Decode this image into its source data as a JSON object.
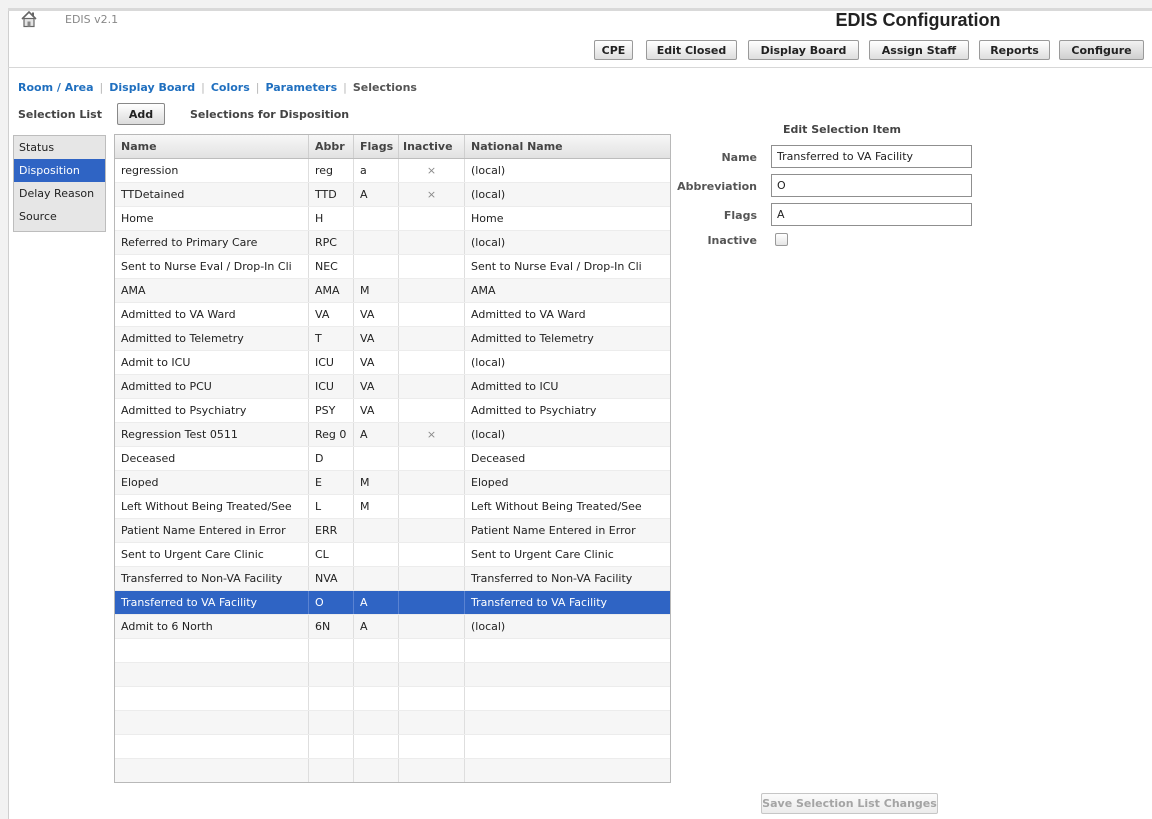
{
  "header": {
    "version": "EDIS v2.1",
    "title": "EDIS Configuration",
    "home_icon": "home-icon"
  },
  "nav": {
    "buttons": [
      "CPE",
      "Edit Closed",
      "Display Board",
      "Assign Staff",
      "Reports",
      "Configure"
    ],
    "active": "Configure"
  },
  "subnav": {
    "links": [
      "Room / Area",
      "Display Board",
      "Colors",
      "Parameters"
    ],
    "current": "Selections"
  },
  "selection_list": {
    "label": "Selection List",
    "items": [
      "Status",
      "Disposition",
      "Delay Reason",
      "Source"
    ],
    "selected": "Disposition"
  },
  "selections": {
    "add_label": "Add",
    "heading": "Selections for Disposition",
    "columns": [
      "Name",
      "Abbr",
      "Flags",
      "Inactive",
      "National Name"
    ],
    "rows": [
      [
        "regression",
        "reg",
        "a",
        "×",
        "(local)"
      ],
      [
        "TTDetained",
        "TTD",
        "A",
        "×",
        "(local)"
      ],
      [
        "Home",
        "H",
        "",
        "",
        "Home"
      ],
      [
        "Referred to Primary Care",
        "RPC",
        "",
        "",
        "(local)"
      ],
      [
        "Sent to Nurse Eval / Drop-In Cli",
        "NEC",
        "",
        "",
        "Sent to Nurse Eval / Drop-In Cli"
      ],
      [
        "AMA",
        "AMA",
        "M",
        "",
        "AMA"
      ],
      [
        "Admitted to VA Ward",
        "VA",
        "VA",
        "",
        "Admitted to VA Ward"
      ],
      [
        "Admitted to Telemetry",
        "T",
        "VA",
        "",
        "Admitted to Telemetry"
      ],
      [
        "Admit to ICU",
        "ICU",
        "VA",
        "",
        "(local)"
      ],
      [
        "Admitted to PCU",
        "ICU",
        "VA",
        "",
        "Admitted to ICU"
      ],
      [
        "Admitted to Psychiatry",
        "PSY",
        "VA",
        "",
        "Admitted to Psychiatry"
      ],
      [
        "Regression Test 0511",
        "Reg 0",
        "A",
        "×",
        "(local)"
      ],
      [
        "Deceased",
        "D",
        "",
        "",
        "Deceased"
      ],
      [
        "Eloped",
        "E",
        "M",
        "",
        "Eloped"
      ],
      [
        "Left Without Being Treated/See",
        "L",
        "M",
        "",
        "Left Without Being Treated/See"
      ],
      [
        "Patient Name Entered in Error",
        "ERR",
        "",
        "",
        "Patient Name Entered in Error"
      ],
      [
        "Sent to Urgent Care Clinic",
        "CL",
        "",
        "",
        "Sent to Urgent Care Clinic"
      ],
      [
        "Transferred to Non-VA Facility",
        "NVA",
        "",
        "",
        "Transferred to Non-VA Facility"
      ],
      [
        "Transferred to VA Facility",
        "O",
        "A",
        "",
        "Transferred to VA Facility"
      ],
      [
        "Admit to 6 North",
        "6N",
        "A",
        "",
        "(local)"
      ]
    ],
    "selected_row": 18
  },
  "edit": {
    "title": "Edit Selection Item",
    "name_label": "Name",
    "name_value": "Transferred to VA Facility",
    "abbr_label": "Abbreviation",
    "abbr_value": "O",
    "flags_label": "Flags",
    "flags_value": "A",
    "inactive_label": "Inactive",
    "inactive_checked": false
  },
  "save_label": "Save Selection List Changes",
  "colors": {
    "selection": "#2f64c4",
    "link": "#1f6fbf"
  }
}
